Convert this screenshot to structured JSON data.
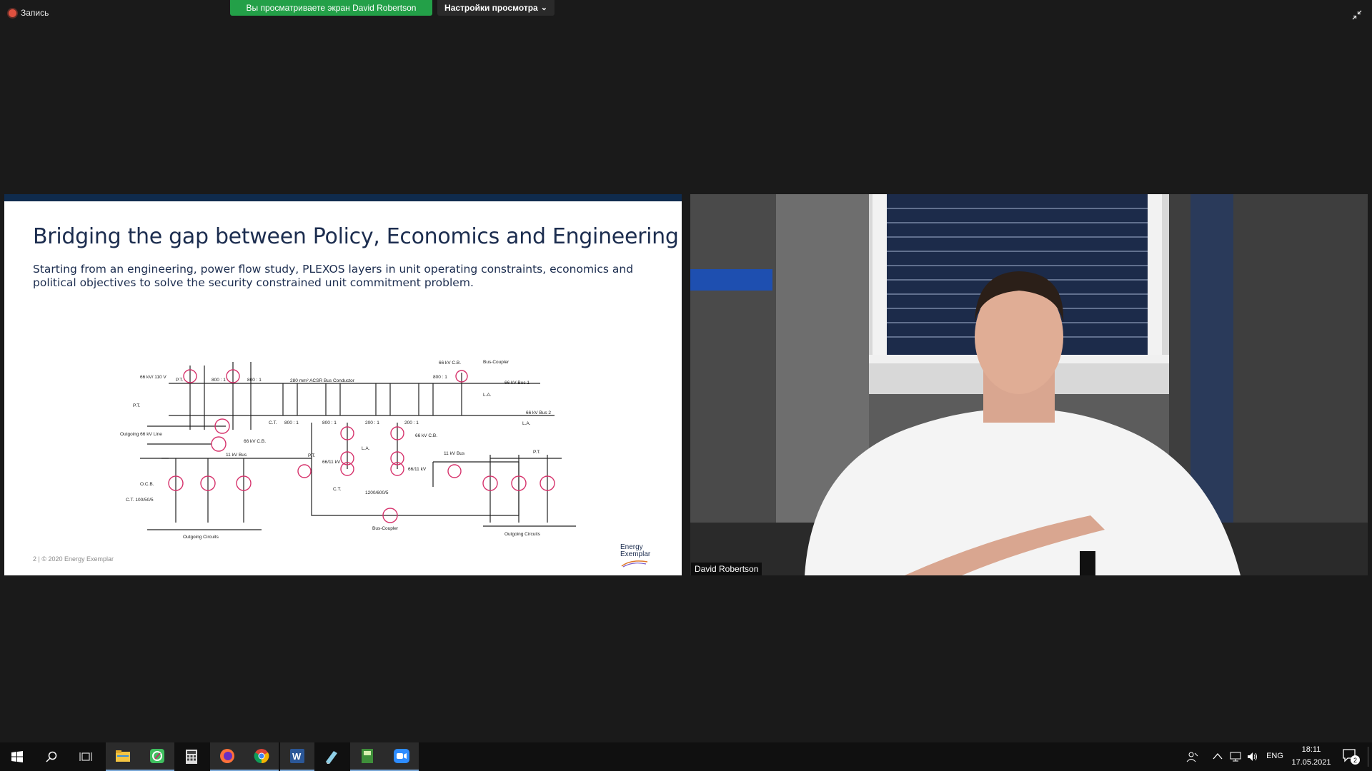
{
  "topbar": {
    "recording_label": "Запись",
    "sharing_label": "Вы просматриваете экран David Robertson",
    "view_options_label": "Настройки просмотра",
    "chevron_glyph": "⌄"
  },
  "slide": {
    "title": "Bridging the gap between Policy, Economics and Engineering",
    "body": "Starting from an engineering, power flow study,  PLEXOS  layers in unit operating constraints, economics and political objectives to solve the security constrained unit commitment problem.",
    "footer": "2   |   © 2020 Energy Exemplar",
    "logo_line1": "Energy",
    "logo_line2": "Exemplar",
    "diagram": {
      "label_66kv_cb_top": "66 kV C.B.",
      "label_bus_coupler_top": "Bus-Coupler",
      "label_800_1_top": "800 : 1",
      "label_66kv_bus1": "66 kV Bus 1",
      "label_la_top": "L.A.",
      "label_acsr": "280 mm² ACSR Bus Conductor",
      "label_66kv_110v": "66 kV/ 110 V",
      "label_pt_left": "P.T.",
      "label_800_1_a": "800 : 1",
      "label_800_1_b": "800 : 1",
      "label_pt_mid": "P.T.",
      "label_66kv_bus2": "66 kV Bus 2",
      "label_ct_a": "C.T.",
      "label_800_1_c": "800 : 1",
      "label_800_1_d": "800 : 1",
      "label_200_1_a": "200 : 1",
      "label_200_1_b": "200 : 1",
      "label_la_right": "L.A.",
      "label_outgoing_66kv": "Outgoing 66 kV Line",
      "label_66kv_cb_mid": "66 kV C.B.",
      "label_66kv_cb_right": "66 kV C.B.",
      "label_la_mid": "L.A.",
      "label_11kv_bus_left": "11 kV Bus",
      "label_pt_11": "P.T.",
      "label_66_11_left": "66/11 kV",
      "label_66_11_right": "66/11 kV",
      "label_11kv_bus_right": "11 kV Bus",
      "label_pt_right": "P.T.",
      "label_ocb": "O.C.B.",
      "label_ct_100": "C.T. 100/50/5",
      "label_ct_b": "C.T.",
      "label_1200": "1200/600/5",
      "label_bus_coupler_bottom": "Bus-Coupler",
      "label_outgoing_left": "Outgoing  Circuits",
      "label_outgoing_right": "Outgoing  Circuits"
    }
  },
  "video": {
    "participant_name": "David Robertson"
  },
  "taskbar": {
    "lang": "ENG",
    "time": "18:11",
    "date": "17.05.2021",
    "notification_count": "2",
    "apps": [
      "start-icon",
      "search-icon",
      "task-view-icon",
      "file-explorer-icon",
      "app-green-icon",
      "calculator-icon",
      "firefox-icon",
      "chrome-icon",
      "word-icon",
      "app-notes-icon",
      "app-book-icon",
      "zoom-icon"
    ]
  },
  "colors": {
    "sharing_green": "#23a048",
    "slide_navy": "#0f2b4d",
    "diagram_pink": "#d6336c",
    "taskbar_bg": "#101010"
  }
}
